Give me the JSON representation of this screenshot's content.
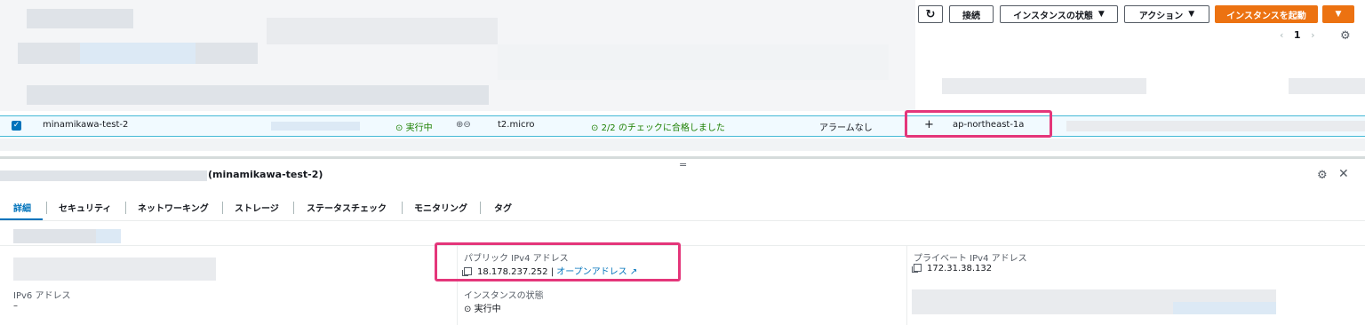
{
  "toolbar": {
    "connect_label": "接続",
    "instance_state_label": "インスタンスの状態",
    "actions_label": "アクション",
    "launch_label": "インスタンスを起動",
    "page_number": "1"
  },
  "selected_row": {
    "name": "minamikawa-test-2",
    "state": "実行中",
    "instance_type": "t2.micro",
    "status_check": "2/2 のチェックに合格しました",
    "alarm": "アラームなし",
    "availability_zone": "ap-northeast-1a"
  },
  "drag_handle": "=",
  "details": {
    "title_suffix": "(minamikawa-test-2)",
    "tabs": [
      "詳細",
      "セキュリティ",
      "ネットワーキング",
      "ストレージ",
      "ステータスチェック",
      "モニタリング",
      "タグ"
    ],
    "public_ipv4_label": "パブリック IPv4 アドレス",
    "public_ipv4_value": "18.178.237.252",
    "public_ipv4_separator": "|",
    "open_address_label": "オープンアドレス",
    "private_ipv4_label": "プライベート IPv4 アドレス",
    "private_ipv4_value": "172.31.38.132",
    "ipv6_label": "IPv6 アドレス",
    "ipv6_value": "–",
    "instance_state_label": "インスタンスの状態",
    "instance_state_value": "実行中"
  },
  "colors": {
    "primary_orange": "#ec7211",
    "link_blue": "#0073bb",
    "success_green": "#1d8102",
    "highlight_pink": "#e4367a"
  }
}
